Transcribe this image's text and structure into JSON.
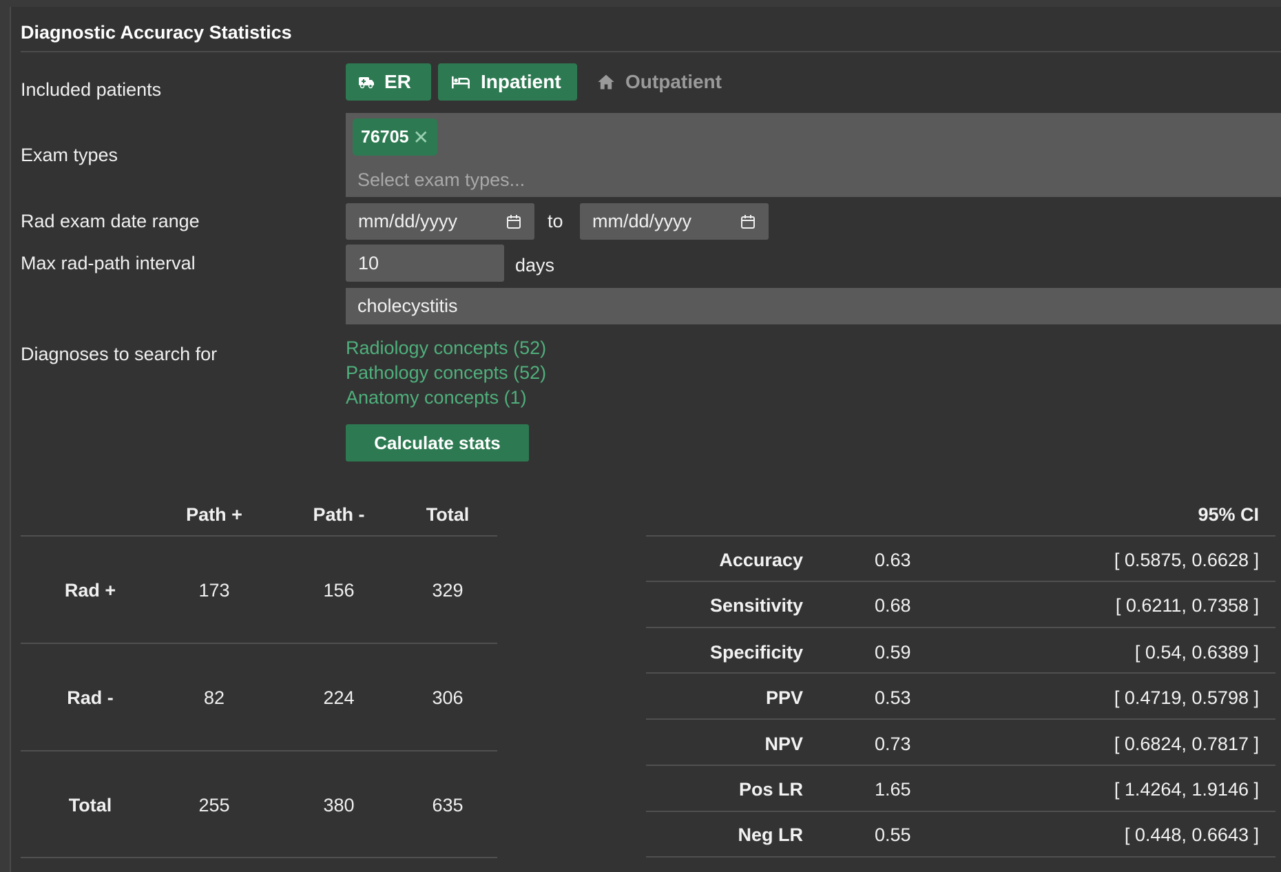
{
  "title": "Diagnostic Accuracy Statistics",
  "labels": {
    "included_patients": "Included patients",
    "exam_types": "Exam types",
    "date_range": "Rad exam date range",
    "max_interval": "Max rad-path interval",
    "diagnoses": "Diagnoses to search for"
  },
  "patient_types": [
    {
      "label": "ER",
      "icon": "ambulance-icon",
      "active": true
    },
    {
      "label": "Inpatient",
      "icon": "bed-icon",
      "active": true
    },
    {
      "label": "Outpatient",
      "icon": "home-icon",
      "active": false
    }
  ],
  "exam_types": {
    "selected_tag": "76705",
    "placeholder": "Select exam types..."
  },
  "date_range": {
    "from_placeholder": "mm/dd/yyyy",
    "to_label": "to",
    "to_placeholder": "mm/dd/yyyy"
  },
  "max_interval": {
    "value": "10",
    "unit": "days"
  },
  "diagnoses": {
    "value": "cholecystitis",
    "links": [
      "Radiology concepts (52)",
      "Pathology concepts (52)",
      "Anatomy concepts (1)"
    ]
  },
  "calculate_button": "Calculate stats",
  "contingency": {
    "headers": [
      "Path +",
      "Path -",
      "Total"
    ],
    "rows": [
      {
        "label": "Rad +",
        "values": [
          "173",
          "156",
          "329"
        ]
      },
      {
        "label": "Rad -",
        "values": [
          "82",
          "224",
          "306"
        ]
      },
      {
        "label": "Total",
        "values": [
          "255",
          "380",
          "635"
        ]
      }
    ]
  },
  "stats": {
    "ci_header": "95% CI",
    "rows": [
      {
        "name": "Accuracy",
        "value": "0.63",
        "ci": "[ 0.5875, 0.6628 ]"
      },
      {
        "name": "Sensitivity",
        "value": "0.68",
        "ci": "[ 0.6211, 0.7358 ]"
      },
      {
        "name": "Specificity",
        "value": "0.59",
        "ci": "[ 0.54, 0.6389 ]"
      },
      {
        "name": "PPV",
        "value": "0.53",
        "ci": "[ 0.4719, 0.5798 ]"
      },
      {
        "name": "NPV",
        "value": "0.73",
        "ci": "[ 0.6824, 0.7817 ]"
      },
      {
        "name": "Pos LR",
        "value": "1.65",
        "ci": "[ 1.4264, 1.9146 ]"
      },
      {
        "name": "Neg LR",
        "value": "0.55",
        "ci": "[ 0.448, 0.6643 ]"
      }
    ]
  },
  "colors": {
    "accent": "#2d7a52",
    "link": "#4fb07c",
    "background": "#333333",
    "field": "#5a5a5a"
  }
}
